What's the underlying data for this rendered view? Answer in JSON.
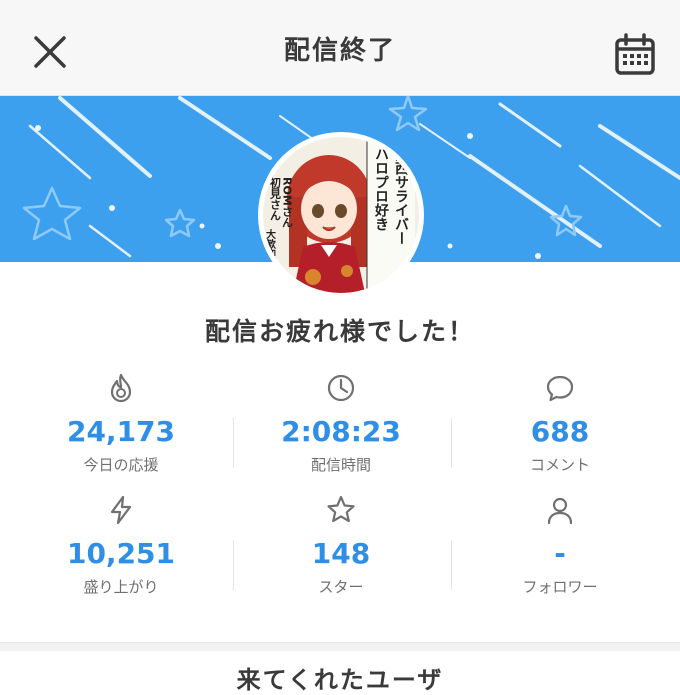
{
  "header": {
    "title": "配信終了",
    "close_icon": "close-icon",
    "calendar_icon": "calendar-icon"
  },
  "banner": {
    "color": "#3da0ee",
    "avatar_texts": [
      "ハロプロ好き",
      "関西サライバー",
      "初見さん",
      "ROMさん",
      "大歓迎！"
    ]
  },
  "message": "配信お疲れ様でした！",
  "stats": [
    {
      "icon": "flame-icon",
      "value": "24,173",
      "label": "今日の応援"
    },
    {
      "icon": "clock-icon",
      "value": "2:08:23",
      "label": "配信時間"
    },
    {
      "icon": "comment-icon",
      "value": "688",
      "label": "コメント"
    },
    {
      "icon": "lightning-icon",
      "value": "10,251",
      "label": "盛り上がり"
    },
    {
      "icon": "star-icon",
      "value": "148",
      "label": "スター"
    },
    {
      "icon": "user-icon",
      "value": "-",
      "label": "フォロワー"
    }
  ],
  "accent_color": "#2f8fe6",
  "next_section": {
    "title": "来てくれたユーザ"
  }
}
